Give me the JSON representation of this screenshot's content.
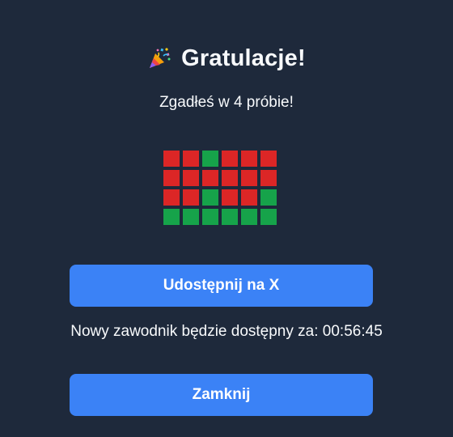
{
  "modal": {
    "title": "Gratulacje!",
    "icon": "party-popper-icon",
    "subtitle": "Zgadłeś w 4 próbie!"
  },
  "guess_grid": {
    "columns": 6,
    "rows": [
      [
        "red",
        "red",
        "green",
        "red",
        "red",
        "red"
      ],
      [
        "red",
        "red",
        "red",
        "red",
        "red",
        "red"
      ],
      [
        "red",
        "red",
        "green",
        "red",
        "red",
        "green"
      ],
      [
        "green",
        "green",
        "green",
        "green",
        "green",
        "green"
      ]
    ]
  },
  "share_button": {
    "label": "Udostępnij na X"
  },
  "next_player": {
    "text": "Nowy zawodnik będzie dostępny za:",
    "countdown": "00:56:45"
  },
  "close_button": {
    "label": "Zamknij"
  },
  "colors": {
    "background": "#1e293b",
    "button": "#3b82f6",
    "red": "#dc2626",
    "green": "#16a34a",
    "text": "#f8fafc"
  }
}
